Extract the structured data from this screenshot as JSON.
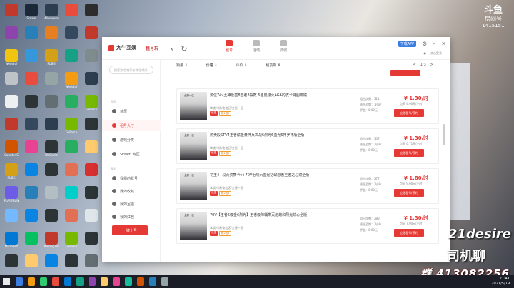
{
  "desktop": {
    "icons": [
      {
        "label": "",
        "color": "#c0392b"
      },
      {
        "label": "Steam",
        "color": "#1b2838"
      },
      {
        "label": "Alienware",
        "color": "#2c3e50"
      },
      {
        "label": "",
        "color": "#e74c3c"
      },
      {
        "label": "",
        "color": "#2d2d2d"
      },
      {
        "label": "",
        "color": "#8e44ad"
      },
      {
        "label": "",
        "color": "#2980b9"
      },
      {
        "label": "",
        "color": "#e67e22"
      },
      {
        "label": "",
        "color": "#34495e"
      },
      {
        "label": "",
        "color": "#c0392b"
      },
      {
        "label": "World of",
        "color": "#f1c40f"
      },
      {
        "label": "",
        "color": "#3498db"
      },
      {
        "label": "PUBG",
        "color": "#d4a017"
      },
      {
        "label": "",
        "color": "#16a085"
      },
      {
        "label": "",
        "color": "#7f8c8d"
      },
      {
        "label": "",
        "color": "#bdc3c7"
      },
      {
        "label": "",
        "color": "#e74c3c"
      },
      {
        "label": "",
        "color": "#95a5a6"
      },
      {
        "label": "World of",
        "color": "#f39c12"
      },
      {
        "label": "",
        "color": "#2c3e50"
      },
      {
        "label": "",
        "color": "#ecf0f1"
      },
      {
        "label": "",
        "color": "#2d3436"
      },
      {
        "label": "",
        "color": "#636e72"
      },
      {
        "label": "",
        "color": "#27ae60"
      },
      {
        "label": "GeForce",
        "color": "#76b900"
      },
      {
        "label": "",
        "color": "#c0392b"
      },
      {
        "label": "",
        "color": "#34495e"
      },
      {
        "label": "",
        "color": "#2c3e50"
      },
      {
        "label": "GeForce",
        "color": "#76b900"
      },
      {
        "label": "",
        "color": "#2d3436"
      },
      {
        "label": "Counter-S",
        "color": "#d35400"
      },
      {
        "label": "",
        "color": "#e84393"
      },
      {
        "label": "WeGame",
        "color": "#2d3436"
      },
      {
        "label": "",
        "color": "#27ae60"
      },
      {
        "label": "",
        "color": "#fdcb6e"
      },
      {
        "label": "PUBG",
        "color": "#d4a017"
      },
      {
        "label": "",
        "color": "#0984e3"
      },
      {
        "label": "",
        "color": "#2d3436"
      },
      {
        "label": "",
        "color": "#e17055"
      },
      {
        "label": "",
        "color": "#d63031"
      },
      {
        "label": "PLAYERUN",
        "color": "#6c5ce7"
      },
      {
        "label": "",
        "color": "#2980b9"
      },
      {
        "label": "",
        "color": "#b2bec3"
      },
      {
        "label": "",
        "color": "#00cec9"
      },
      {
        "label": "",
        "color": "#2d3436"
      },
      {
        "label": "",
        "color": "#74b9ff"
      },
      {
        "label": "",
        "color": "#0984e3"
      },
      {
        "label": "",
        "color": "#2d3436"
      },
      {
        "label": "",
        "color": "#e17055"
      },
      {
        "label": "",
        "color": "#dfe6e9"
      },
      {
        "label": "Microsoft",
        "color": "#0078d4"
      },
      {
        "label": "",
        "color": "#07c160"
      },
      {
        "label": "Among Us",
        "color": "#c0392b"
      },
      {
        "label": "GeForce",
        "color": "#76b900"
      },
      {
        "label": "",
        "color": "#2d3436"
      },
      {
        "label": "",
        "color": "#2d3436"
      },
      {
        "label": "",
        "color": "#fdcb6e"
      },
      {
        "label": "",
        "color": "#0984e3"
      },
      {
        "label": "",
        "color": "#2d3436"
      },
      {
        "label": "",
        "color": "#636e72"
      }
    ]
  },
  "overlay": {
    "stream_brand": "斗鱼",
    "stream_sub": "房间号",
    "room_number": "1415151",
    "streamer_name": "21desire",
    "streamer_tag": "司机聊",
    "qq_group": "群 413082256"
  },
  "app": {
    "logo_text": "九牛互娱",
    "logo_sub": "租号玩",
    "top_tabs": [
      {
        "label": "租号",
        "active": true
      },
      {
        "label": "活动",
        "active": false
      },
      {
        "label": "商城",
        "active": false
      }
    ],
    "download_label": "下载APP",
    "user_label": "点击登录",
    "search_placeholder": "搜索游戏/商家名称/游戏号",
    "section_home": "租号",
    "nav_items": [
      {
        "label": "首页",
        "active": false
      },
      {
        "label": "租号大厅",
        "active": true
      },
      {
        "label": "游戏分类",
        "active": false
      },
      {
        "label": "Steam 专区",
        "active": false
      }
    ],
    "section_mine": "我的",
    "mine_items": [
      {
        "label": "我租的账号"
      },
      {
        "label": "我的收藏"
      },
      {
        "label": "我的足迹"
      },
      {
        "label": "我的红包"
      }
    ],
    "sell_button": "一键上号",
    "sort": [
      {
        "label": "销量 ⬇",
        "on": false
      },
      {
        "label": "价格 ⬇",
        "on": true
      },
      {
        "label": "评价 ⬇",
        "on": false
      },
      {
        "label": "租赁期 ⬇",
        "on": false
      }
    ],
    "pager": {
      "prev": "<",
      "page": "1/3",
      "next": ">"
    },
    "listings": [
      {
        "thumb_label": "全服一区",
        "title": "热位74v土神低签8王者3段数 6色皮级灭AG6的皮卡特图瞰镜",
        "server": "掌锁人场/电信区/全服一区",
        "tags": [
          "优惠",
          "租2送1"
        ],
        "stat1": "租出次数：314",
        "stat2": "最低租期：1小时",
        "stat3": "押金：0.00元",
        "price": "¥ 1.30/时",
        "sub_price": "包天 4.00元/小时",
        "rent_label": "立即租号/预约"
      },
      {
        "thumb_label": "全服一区",
        "title": "热卖段STV4王者炫金黄神兵决战6烈光6血光6神罗神版全版",
        "server": "掌锁人场/电信区/全服一区",
        "tags": [
          "优惠",
          "租2送1"
        ],
        "stat1": "租出次数：357",
        "stat2": "最低租期：1小时",
        "stat3": "押金：0.00元",
        "price": "¥ 1.30/时",
        "sub_price": "包天 6.71元/小时",
        "rent_label": "立即租号/预约"
      },
      {
        "thumb_label": "全服一区",
        "title": "初王4+段灭资质卡v+70V七烈六血光钻幻想者王者之心双全版",
        "server": "掌锁人场/电信区/全服一区",
        "tags": [
          "优惠",
          "租2送1"
        ],
        "stat1": "租出次数：277",
        "stat2": "最低租期：1小时",
        "stat3": "押金：0.00元",
        "price": "¥ 1.80/时",
        "sub_price": "包天 9.60元/小时",
        "rent_label": "立即租号/预约"
      },
      {
        "thumb_label": "全服一区",
        "title": "70V【王者6级金6烈光】王者级阵辅带灭炮炮和烈光炫心全版",
        "server": "掌锁人场/电信区/全服一区",
        "tags": [
          "优惠",
          "租2送1"
        ],
        "stat1": "租出次数：289",
        "stat2": "最低租期：1小时",
        "stat3": "押金：0.00元",
        "price": "¥ 1.30/时",
        "sub_price": "包天 7.00元/小时",
        "rent_label": "立即租号/预约"
      }
    ]
  },
  "taskbar": {
    "time": "21:41",
    "date": "2021/5/19",
    "apps": [
      "#3b7de0",
      "#f39c12",
      "#2ecc71",
      "#e74c3c",
      "#0078d4",
      "#16a085",
      "#8e44ad",
      "#fdcb6e",
      "#e84393",
      "#1abc9c",
      "#d35400",
      "#2980b9",
      "#95a5a6"
    ]
  }
}
